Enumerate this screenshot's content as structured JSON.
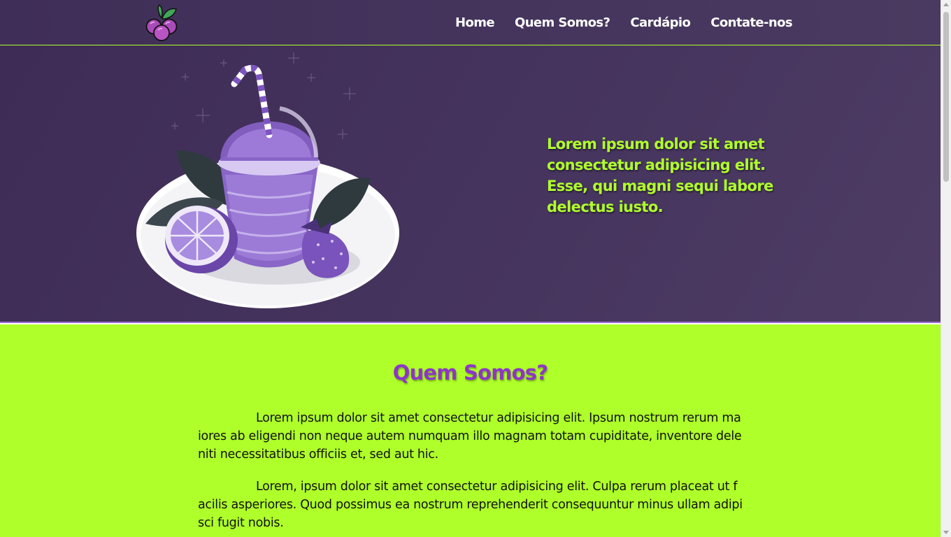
{
  "nav": {
    "items": [
      {
        "label": "Home"
      },
      {
        "label": "Quem Somos?"
      },
      {
        "label": "Cardápio"
      },
      {
        "label": "Contate-nos"
      }
    ]
  },
  "hero": {
    "text": "Lorem ipsum dolor sit amet consectetur adipisicing elit. Esse, qui magni sequi labore delectus iusto."
  },
  "about": {
    "title": "Quem Somos?",
    "paragraphs": [
      "Lorem ipsum dolor sit amet consectetur adipisicing elit. Ipsum nostrum rerum maiores ab eligendi non neque autem numquam illo magnam totam cupiditate, inventore deleniti necessitatibus officiis et, sed aut hic.",
      "Lorem, ipsum dolor sit amet consectetur adipisicing elit. Culpa rerum placeat ut facilis asperiores. Quod possimus ea nostrum reprehenderit consequuntur minus ullam adipisci fugit nobis."
    ]
  },
  "icons": {
    "logo": "berry-logo-icon",
    "hero_image": "smoothie-cup-illustration"
  },
  "colors": {
    "header_bg": "#3f2e57",
    "accent_green": "#b0ff2c",
    "about_bg": "#afff2a",
    "title_purple": "#8e35c8",
    "nav_text": "#ffffff"
  }
}
